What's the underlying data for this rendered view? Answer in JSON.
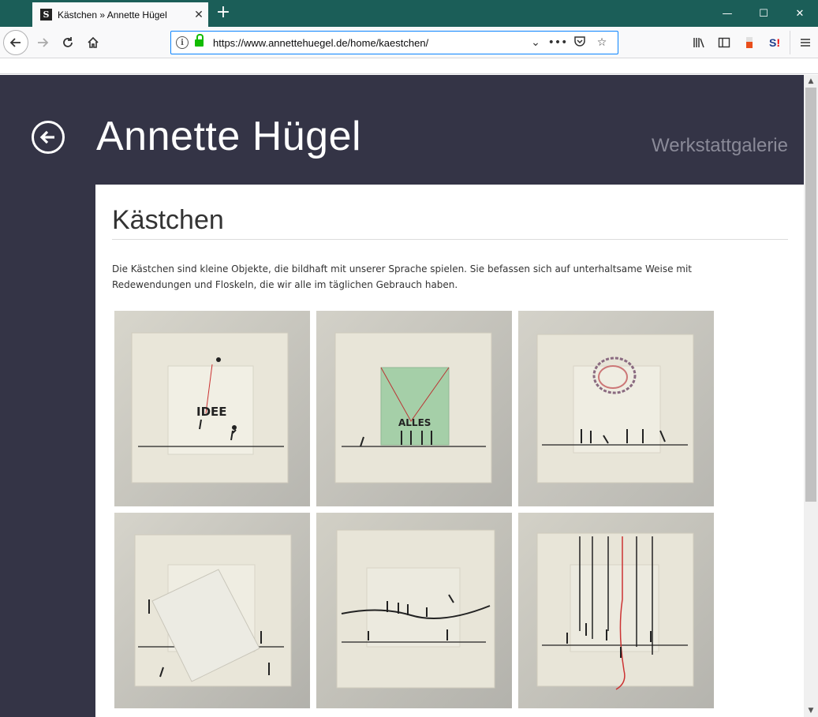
{
  "browser": {
    "tab_title": "Kästchen » Annette Hügel",
    "tab_favicon": "S",
    "tab_close": "✕",
    "new_tab": "+",
    "url": "https://www.annettehuegel.de/home/kaestchen/",
    "window_controls": [
      "—",
      "☐",
      "✕"
    ]
  },
  "site": {
    "title": "Annette Hügel",
    "subtitle": "Werkstattgalerie",
    "back_icon": "←"
  },
  "page": {
    "heading": "Kästchen",
    "intro": "Die Kästchen sind kleine Objekte, die bildhaft mit unserer Sprache spielen. Sie befassen sich auf unterhaltsame Weise mit Redewendungen und Floskeln, die wir alle im täglichen Gebrauch haben."
  },
  "gallery": {
    "items": [
      {
        "word": "IDEE"
      },
      {
        "word": "ALLES"
      },
      {
        "word": ""
      },
      {
        "word": ""
      },
      {
        "word": ""
      },
      {
        "word": ""
      }
    ]
  }
}
